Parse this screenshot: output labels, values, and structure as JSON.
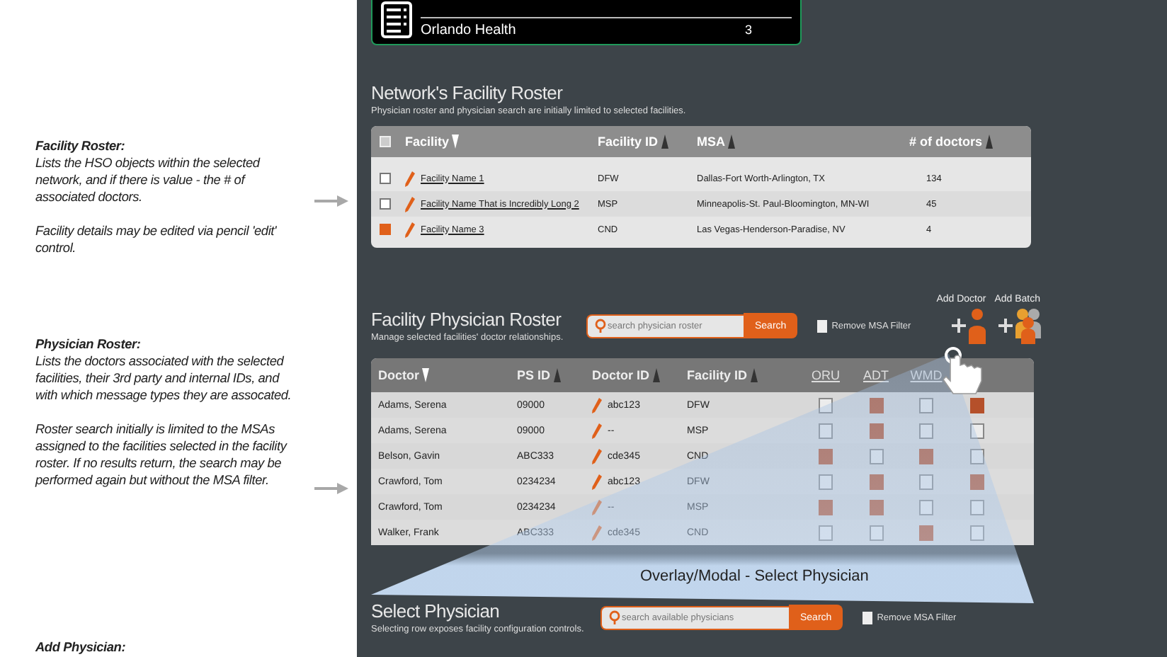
{
  "annotations": [
    {
      "heading": "Facility Roster:",
      "paragraphs": [
        "Lists the HSO objects within the selected network, and if there is value - the # of associated doctors.",
        "Facility details may be edited via pencil 'edit' control."
      ],
      "arrow": true
    },
    {
      "heading": "Physician Roster:",
      "paragraphs": [
        "Lists the doctors associated with the selected facilities, their 3rd party and internal IDs, and with which message types they are assocated.",
        "Roster search initially is limited to the MSAs assigned to the facilities selected in the facility roster.  If no results return, the search may be performed again but without the MSA filter."
      ],
      "arrow": true
    },
    {
      "heading": "Add Physician:",
      "arrow": false
    }
  ],
  "network_card": {
    "name": "Orlando Health",
    "count": "3"
  },
  "facility_roster": {
    "title": "Network's Facility Roster",
    "subtitle": "Physician roster and physician search are initially limited to selected facilities.",
    "all_selected": false,
    "columns": [
      {
        "label": "Facility",
        "descending": true
      },
      {
        "label": "Facility ID",
        "descending": false
      },
      {
        "label": "MSA",
        "descending": false
      },
      {
        "label": "# of doctors",
        "descending": false
      }
    ],
    "rows": [
      {
        "name": "Facility Name 1",
        "id": "DFW",
        "msa": "Dallas-Fort Worth-Arlington, TX",
        "doctors": "134",
        "selected": false
      },
      {
        "name": "Facility Name That is Incredibly Long 2",
        "id": "MSP",
        "msa": "Minneapolis-St. Paul-Bloomington, MN-WI",
        "doctors": "45",
        "selected": false
      },
      {
        "name": "Facility Name 3",
        "id": "CND",
        "msa": "Las Vegas-Henderson-Paradise, NV",
        "doctors": "4",
        "selected": true
      }
    ]
  },
  "physician_roster": {
    "title": "Facility Physician Roster",
    "subtitle": "Manage selected facilities' doctor relationships.",
    "search": {
      "placeholder": "search physician roster",
      "button": "Search"
    },
    "msa_filter": {
      "label": "Remove MSA Filter",
      "checked": false
    },
    "add_doctor": "Add Doctor",
    "add_batch": "Add Batch",
    "columns": [
      {
        "label": "Doctor",
        "descending": true
      },
      {
        "label": "PS ID",
        "descending": false
      },
      {
        "label": "Doctor ID",
        "descending": false
      },
      {
        "label": "Facility ID",
        "descending": false
      }
    ],
    "message_columns": [
      {
        "label": "ORU"
      },
      {
        "label": "ADT"
      },
      {
        "label": "WMD"
      },
      {}
    ],
    "rows": [
      {
        "doctor": "Adams, Serena",
        "ps_id": "09000",
        "doctor_id": "abc123",
        "facility_id": "DFW",
        "messages": [
          false,
          true,
          false,
          true
        ]
      },
      {
        "doctor": "Adams, Serena",
        "ps_id": "09000",
        "doctor_id": "--",
        "facility_id": "MSP",
        "messages": [
          false,
          true,
          false,
          false
        ]
      },
      {
        "doctor": "Belson, Gavin",
        "ps_id": "ABC333",
        "doctor_id": "cde345",
        "facility_id": "CND",
        "messages": [
          true,
          false,
          true,
          false
        ]
      },
      {
        "doctor": "Crawford, Tom",
        "ps_id": "0234234",
        "doctor_id": "abc123",
        "facility_id": "DFW",
        "messages": [
          false,
          true,
          false,
          true
        ]
      },
      {
        "doctor": "Crawford, Tom",
        "ps_id": "0234234",
        "doctor_id": "--",
        "facility_id": "MSP",
        "messages": [
          true,
          true,
          false,
          false
        ]
      },
      {
        "doctor": "Walker, Frank",
        "ps_id": "ABC333",
        "doctor_id": "cde345",
        "facility_id": "CND",
        "messages": [
          false,
          false,
          true,
          false
        ]
      }
    ]
  },
  "overlay_label": "Overlay/Modal - Select Physician",
  "select_physician": {
    "title": "Select Physician",
    "subtitle": "Selecting row exposes facility configuration controls.",
    "search": {
      "placeholder": "search available physicians",
      "button": "Search"
    },
    "msa_filter": {
      "label": "Remove MSA Filter",
      "checked": false
    }
  }
}
